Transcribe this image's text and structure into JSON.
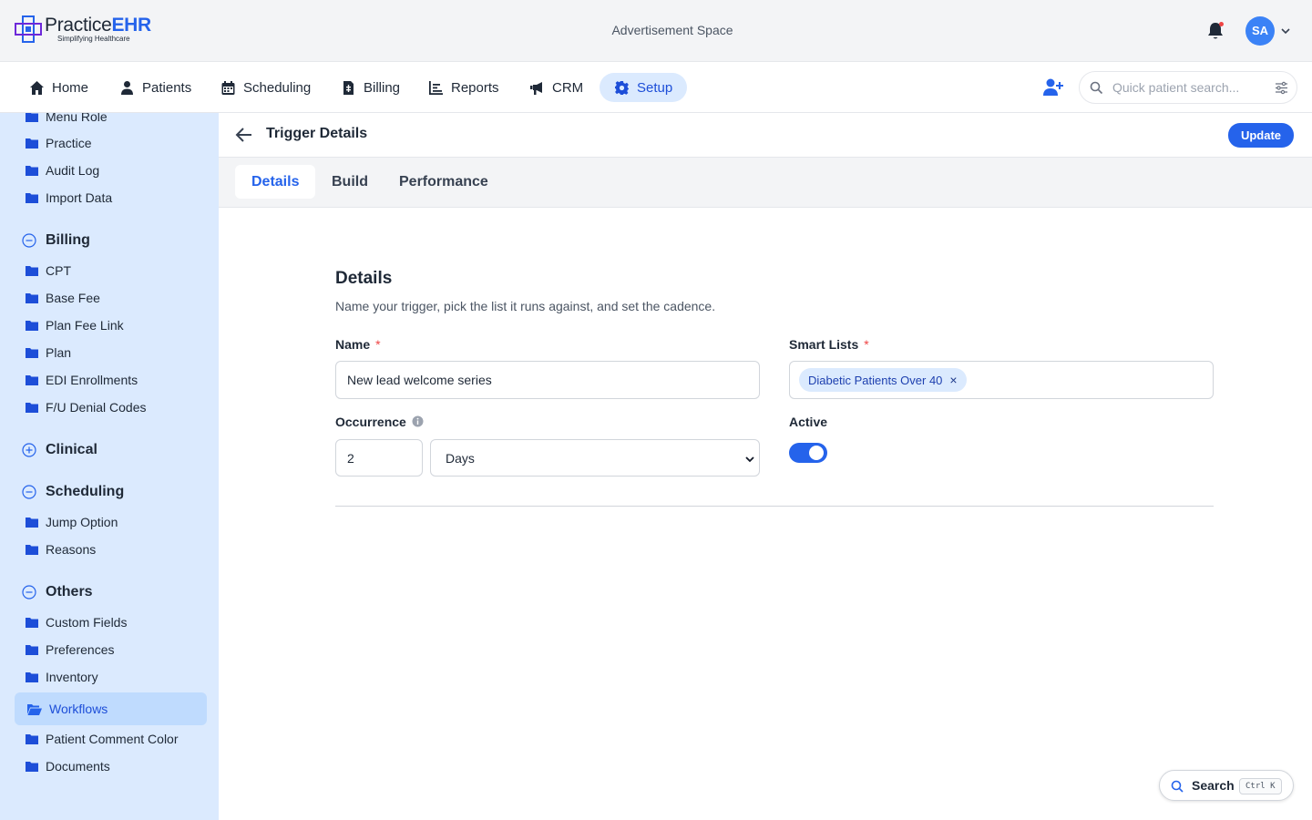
{
  "brand": {
    "name_prefix": "Practice",
    "name_suffix": "EHR",
    "tagline": "Simplifying Healthcare",
    "accent": "#2563eb"
  },
  "header": {
    "ad_text": "Advertisement Space",
    "avatar_initials": "SA"
  },
  "nav": {
    "items": [
      {
        "label": "Home",
        "icon": "home-icon"
      },
      {
        "label": "Patients",
        "icon": "patients-icon"
      },
      {
        "label": "Scheduling",
        "icon": "calendar-icon"
      },
      {
        "label": "Billing",
        "icon": "billing-icon"
      },
      {
        "label": "Reports",
        "icon": "reports-icon"
      },
      {
        "label": "CRM",
        "icon": "megaphone-icon"
      },
      {
        "label": "Setup",
        "icon": "gear-icon",
        "active": true
      }
    ],
    "search_placeholder": "Quick patient search..."
  },
  "sidebar": {
    "top_items": [
      "Menu Role",
      "Practice",
      "Audit Log",
      "Import Data"
    ],
    "groups": [
      {
        "title": "Billing",
        "expanded": true,
        "items": [
          "CPT",
          "Base Fee",
          "Plan Fee Link",
          "Plan",
          "EDI Enrollments",
          "F/U Denial Codes"
        ]
      },
      {
        "title": "Clinical",
        "expanded": false,
        "items": []
      },
      {
        "title": "Scheduling",
        "expanded": true,
        "items": [
          "Jump Option",
          "Reasons"
        ]
      },
      {
        "title": "Others",
        "expanded": true,
        "items": [
          "Custom Fields",
          "Preferences",
          "Inventory",
          "Workflows",
          "Patient Comment Color",
          "Documents"
        ]
      }
    ],
    "active_item": "Workflows"
  },
  "page": {
    "title": "Trigger Details",
    "update_label": "Update",
    "tabs": [
      {
        "label": "Details",
        "active": true
      },
      {
        "label": "Build",
        "active": false
      },
      {
        "label": "Performance",
        "active": false
      }
    ]
  },
  "form": {
    "section_title": "Details",
    "section_desc": "Name your trigger, pick the list it runs against, and set the cadence.",
    "name_label": "Name",
    "name_value": "New lead welcome series",
    "smart_lists_label": "Smart Lists",
    "smart_list_chip": "Diabetic Patients Over 40",
    "occurrence_label": "Occurrence",
    "occurrence_value": "2",
    "occurrence_unit": "Days",
    "active_label": "Active",
    "active_on": true,
    "required_mark": "*"
  },
  "search_fab": {
    "label": "Search",
    "shortcut": "Ctrl K"
  }
}
